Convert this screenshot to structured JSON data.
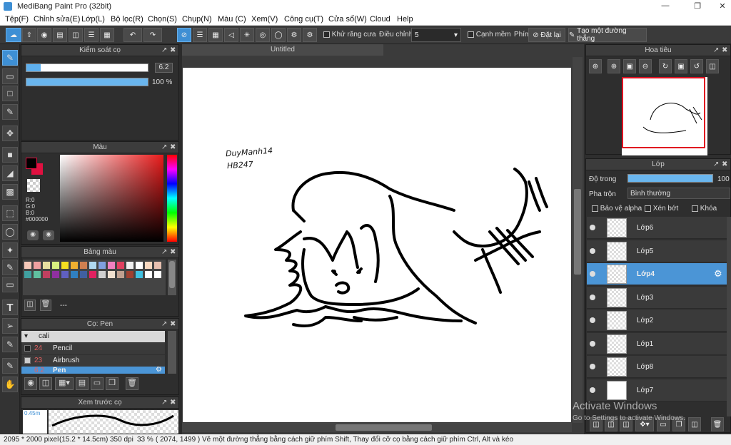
{
  "window": {
    "title": "MediBang Paint Pro (32bit)"
  },
  "menu": [
    "Tệp(F)",
    "Chỉnh sửa(E)",
    "Lớp(L)",
    "Bộ lọc(R)",
    "Chọn(S)",
    "Chụp(N)",
    "Màu (C)",
    "Xem(V)",
    "Công cụ(T)",
    "Cửa sổ(W)",
    "Cloud",
    "Help"
  ],
  "toolbar": {
    "antialias_label": "Khử răng cưa",
    "adjust_label": "Điều chỉnh",
    "adjust_value": "5",
    "edge_label": "Cạnh mềm",
    "shortcut_label": "Phím",
    "reset_label": "Đặt lại",
    "line_label": "Tạo một đường thẳng"
  },
  "brush_control": {
    "title": "Kiểm soát cọ",
    "size": "6.2",
    "opacity": "100 %"
  },
  "color_panel": {
    "title": "Màu",
    "r": "R:0",
    "g": "G:0",
    "b": "B:0",
    "hex": "#000000"
  },
  "palette": {
    "title": "Bảng màu",
    "name": "---",
    "colors": [
      "#f5c8b8",
      "#f0a0a0",
      "#e8e0a0",
      "#d8f080",
      "#f5e020",
      "#f0b030",
      "#d08050",
      "#b0d8f0",
      "#80a0e0",
      "#f080c0",
      "#e04060",
      "#f0f0f0",
      "#ffffff",
      "#f8d8c0",
      "#e8c0b0",
      "#40a0a0",
      "#60c0a0",
      "#c04060",
      "#9030a0",
      "#6060c0",
      "#3080c0",
      "#4060a0",
      "#e02060",
      "#d0d0d0",
      "#f0e0d0",
      "#c0a090",
      "#a04030",
      "#40c0e0",
      "#ffffff",
      "#ffffff"
    ]
  },
  "brush_panel": {
    "title": "Cọ: Pen",
    "group": "cali",
    "items": [
      {
        "num": "24",
        "name": "Pencil"
      },
      {
        "num": "23",
        "name": "Airbrush"
      },
      {
        "num": "6.2",
        "name": "Pen"
      }
    ]
  },
  "preview_panel": {
    "title": "Xem trước cọ",
    "size": "0.45m"
  },
  "document": {
    "tab": "Untitled",
    "sig1": "DuyManh14",
    "sig2": "HB247"
  },
  "navigator": {
    "title": "Hoa tiêu"
  },
  "layers": {
    "title": "Lớp",
    "opacity_label": "Độ trong",
    "opacity_value": "100 %",
    "blend_label": "Pha trộn",
    "blend_value": "Bình thường",
    "protect_alpha": "Bảo vệ alpha",
    "clipping": "Xén bớt",
    "lock": "Khóa",
    "items": [
      "Lớp6",
      "Lớp5",
      "Lớp4",
      "Lớp3",
      "Lớp2",
      "Lớp1",
      "Lớp8",
      "Lớp7"
    ],
    "selected_index": 2
  },
  "watermark": {
    "line1": "Activate Windows",
    "line2": "Go to Settings to activate Windows."
  },
  "status": {
    "size": "2095 * 2000 pixel",
    "cm": "(15.2 * 14.5cm)",
    "dpi": "350 dpi",
    "zoom": "33 %",
    "coords": "( 2074, 1499 )",
    "hint": "Vẽ một đường thẳng bằng cách giữ phím Shift, Thay đổi cỡ cọ bằng cách giữ phím Ctrl, Alt và kéo"
  },
  "colors": {
    "accent": "#3e8fd4",
    "panel": "#2e2e2e",
    "fg_color": "#000000",
    "bg_color": "#e01040"
  },
  "icons": [
    "cloud-icon",
    "export-icon",
    "undo-icon",
    "redo-icon",
    "brush-icon",
    "eraser-icon",
    "gear-icon",
    "close-icon",
    "eye-icon",
    "new-layer-icon",
    "trash-icon",
    "zoom-in-icon",
    "zoom-out-icon"
  ]
}
